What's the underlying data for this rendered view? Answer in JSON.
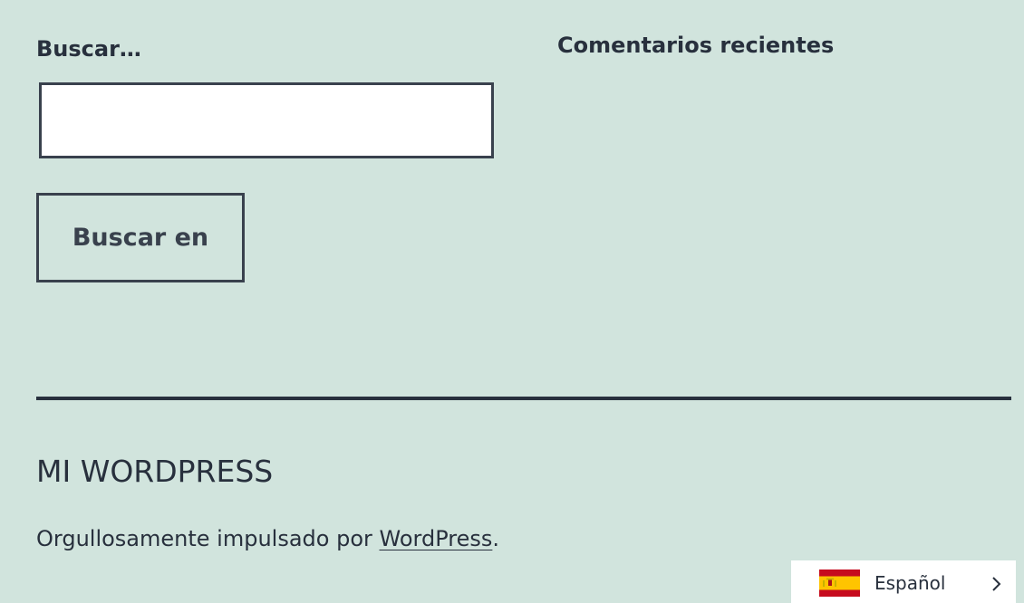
{
  "search": {
    "label": "Buscar…",
    "input_value": "",
    "button_label": "Buscar en"
  },
  "widgets": {
    "recent_comments_title": "Comentarios recientes"
  },
  "footer": {
    "site_title": "MI WORDPRESS",
    "powered_prefix": "Orgullosamente impulsado por ",
    "powered_link": "WordPress",
    "powered_suffix": "."
  },
  "language_switcher": {
    "current_language": "Español",
    "flag_icon": "spain-flag-icon",
    "chevron_icon": "chevron-right-icon"
  },
  "colors": {
    "background": "#d1e4dd",
    "text": "#28303d",
    "border": "#39414d",
    "flag_red": "#c60b1e",
    "flag_yellow": "#ffc400"
  }
}
